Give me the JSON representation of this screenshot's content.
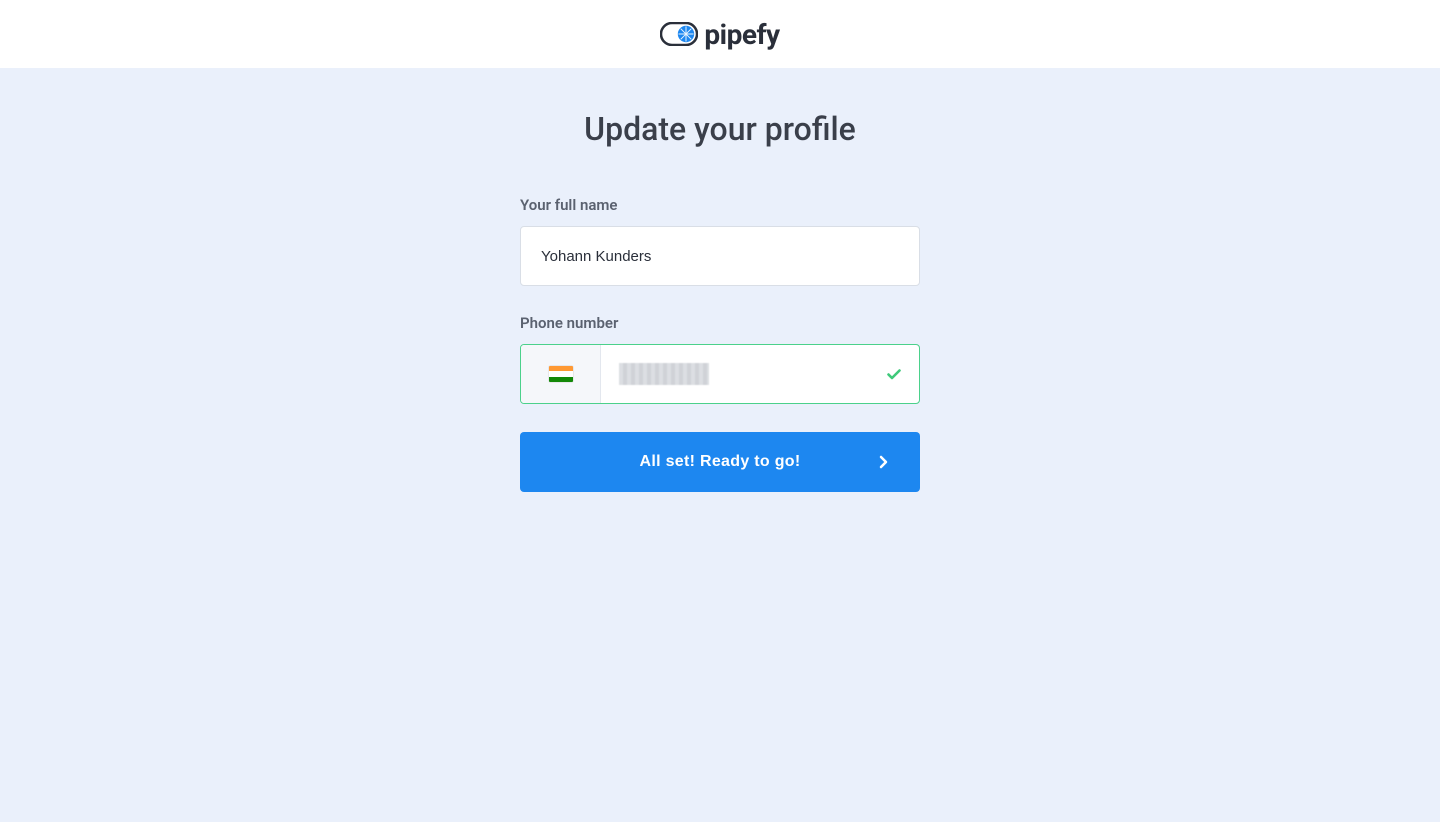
{
  "header": {
    "brand_text": "pipefy"
  },
  "page": {
    "title": "Update your profile"
  },
  "form": {
    "full_name": {
      "label": "Your full name",
      "value": "Yohann Kunders"
    },
    "phone": {
      "label": "Phone number",
      "country": "India",
      "flag_colors": [
        "#ff9933",
        "#ffffff",
        "#138808"
      ],
      "value_redacted": true,
      "valid": true
    },
    "submit": {
      "label": "All set! Ready to go!"
    }
  },
  "colors": {
    "page_bg": "#eaf0fb",
    "primary": "#1d87f0",
    "success": "#3fc97a",
    "success_border": "#4bd18b",
    "text_heading": "#3a3f4a",
    "text_label": "#5b6270"
  }
}
